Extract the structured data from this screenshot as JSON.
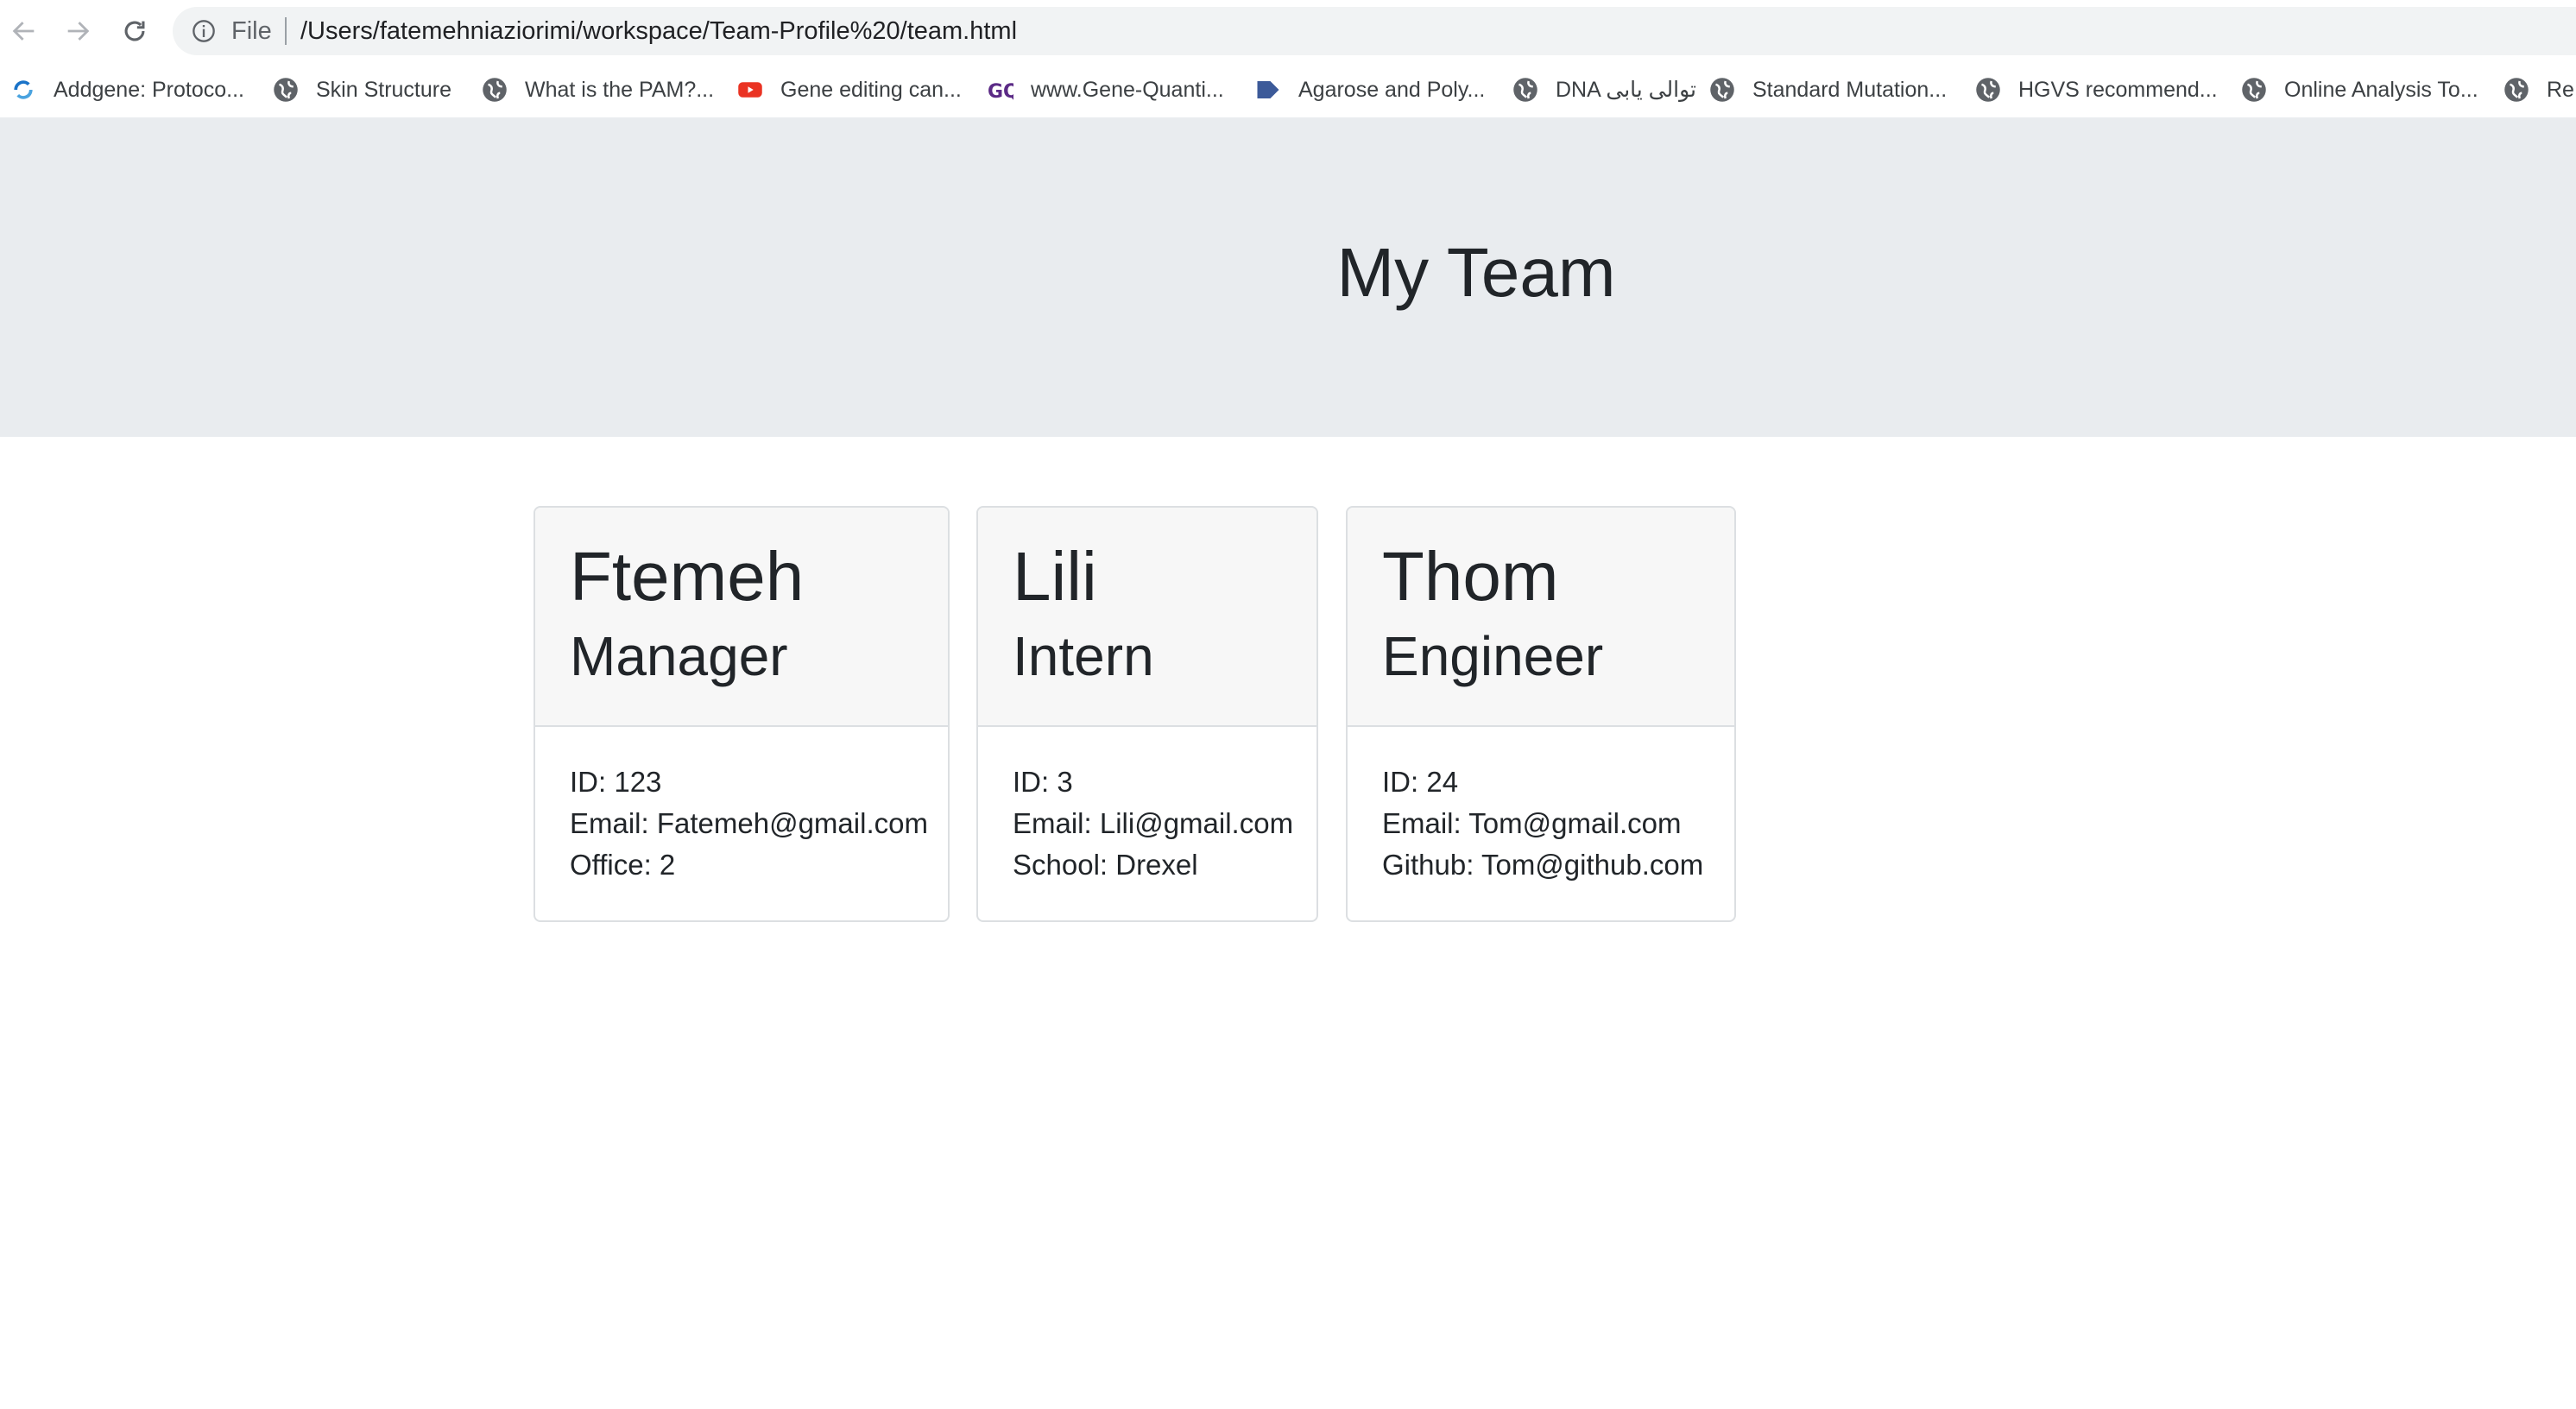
{
  "browser": {
    "file_label": "File",
    "url": "/Users/fatemehniaziorimi/workspace/Team-Profile%20/team.html",
    "bookmarks": [
      {
        "label": "Addgene: Protoco...",
        "icon": "addgene-icon"
      },
      {
        "label": "Skin Structure",
        "icon": "globe-icon"
      },
      {
        "label": "What is the PAM?...",
        "icon": "globe-icon"
      },
      {
        "label": "Gene editing can...",
        "icon": "youtube-icon"
      },
      {
        "label": "www.Gene-Quanti...",
        "icon": "gq-icon"
      },
      {
        "label": "Agarose and Poly...",
        "icon": "doc-icon"
      },
      {
        "label": "DNA توالی یابی",
        "icon": "globe-icon"
      },
      {
        "label": "Standard Mutation...",
        "icon": "globe-icon"
      },
      {
        "label": "HGVS recommend...",
        "icon": "globe-icon"
      },
      {
        "label": "Online Analysis To...",
        "icon": "globe-icon"
      },
      {
        "label": "Re",
        "icon": "globe-icon"
      }
    ]
  },
  "page": {
    "title": "My Team",
    "cards": [
      {
        "name": "Ftemeh",
        "role": "Manager",
        "lines": [
          "ID: 123",
          "Email: Fatemeh@gmail.com",
          "Office: 2"
        ]
      },
      {
        "name": "Lili",
        "role": "Intern",
        "lines": [
          "ID: 3",
          "Email: Lili@gmail.com",
          "School: Drexel"
        ]
      },
      {
        "name": "Thom",
        "role": "Engineer",
        "lines": [
          "ID: 24",
          "Email: Tom@gmail.com",
          "Github: Tom@github.com"
        ]
      }
    ]
  },
  "colors": {
    "jumbotron": "#e9ecef",
    "card_header": "#f7f7f7",
    "youtube_red": "#ea3323",
    "gq_purple": "#5b2a86",
    "addgene_blue": "#1a73c8"
  }
}
